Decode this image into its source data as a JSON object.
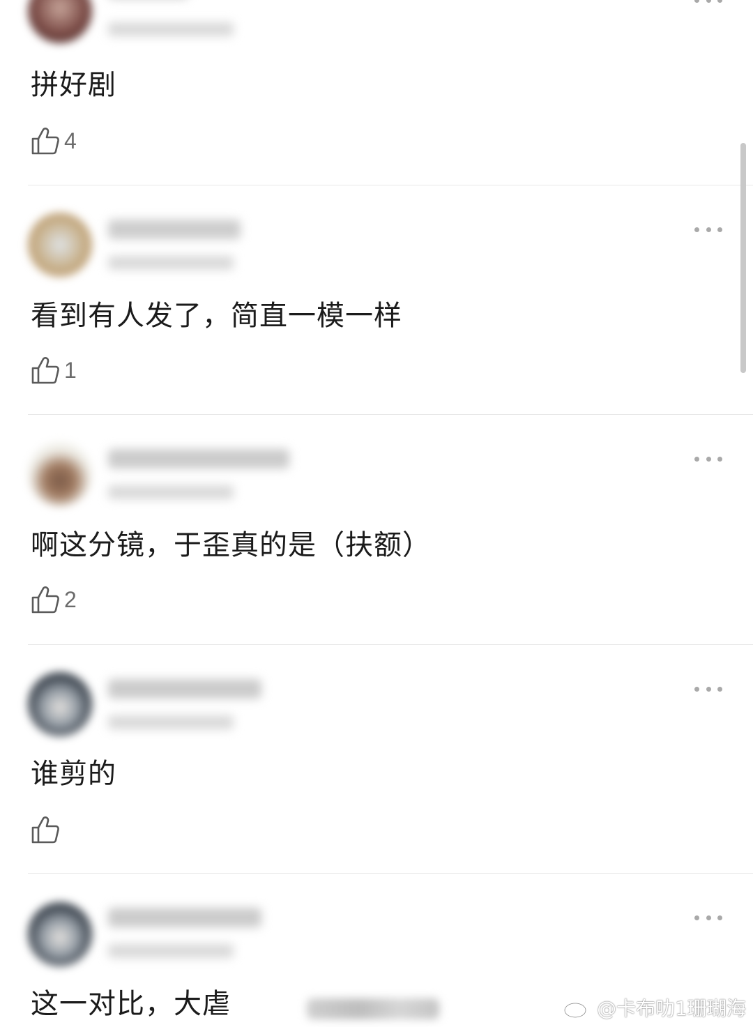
{
  "comments": [
    {
      "text": "拼好剧",
      "likes": "4"
    },
    {
      "text": "看到有人发了，简直一模一样",
      "likes": "1"
    },
    {
      "text": "啊这分镜，于歪真的是（扶额）",
      "likes": "2"
    },
    {
      "text": "谁剪的",
      "likes": ""
    },
    {
      "text": "这一对比，大虐",
      "likes": ""
    }
  ],
  "watermark": {
    "text": "@卡布叻1珊瑚海",
    "icon": "weibo-logo-icon"
  },
  "icons": {
    "like": "thumbs-up-icon",
    "more": "more-dots-icon"
  },
  "colors": {
    "text": "#1b1b1b",
    "muted": "#6b6b6b",
    "divider": "#e8e8e8"
  }
}
